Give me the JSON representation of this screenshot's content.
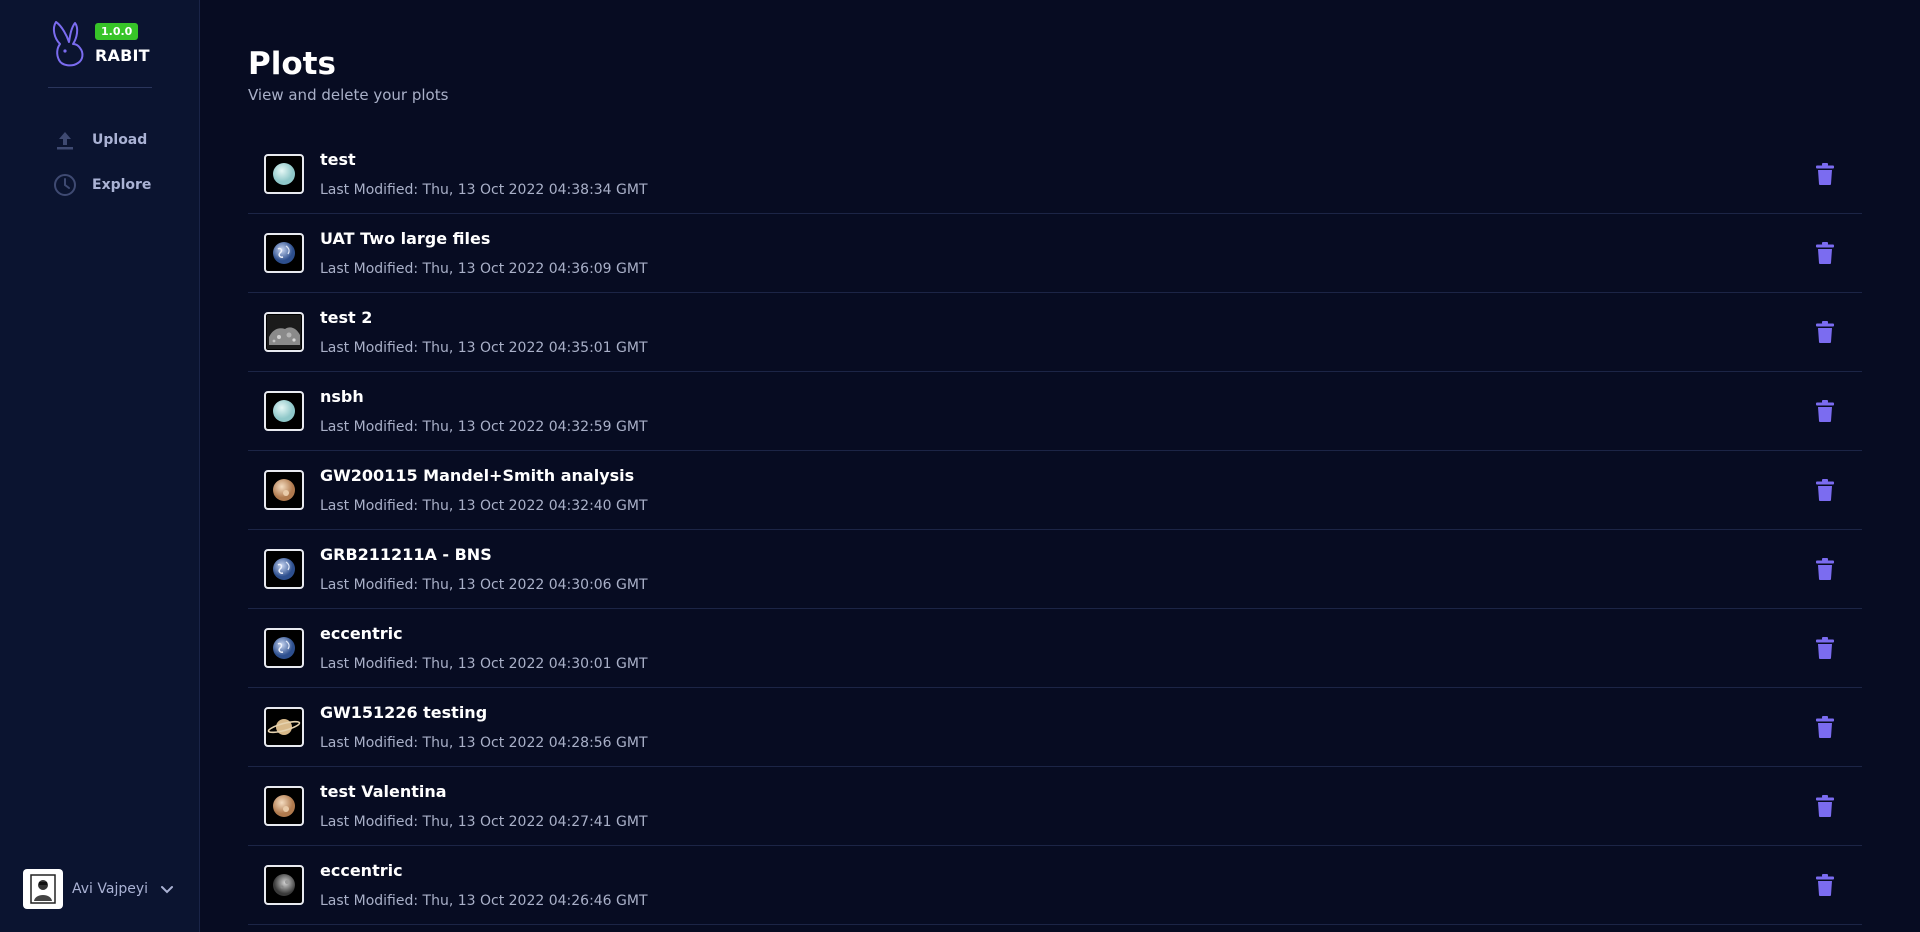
{
  "sidebar": {
    "version": "1.0.0",
    "app_name": "RABIT",
    "nav": [
      {
        "label": "Upload",
        "icon": "upload-icon"
      },
      {
        "label": "Explore",
        "icon": "clock-icon"
      }
    ],
    "user": {
      "name": "Avi Vajpeyi",
      "icon": "chevron-down-icon"
    }
  },
  "main": {
    "title": "Plots",
    "subtitle": "View and delete your plots"
  },
  "plots": [
    {
      "title": "test",
      "modified": "Last Modified: Thu, 13 Oct 2022 04:38:34 GMT",
      "thumb": "uranus"
    },
    {
      "title": "UAT Two large files",
      "modified": "Last Modified: Thu, 13 Oct 2022 04:36:09 GMT",
      "thumb": "earth"
    },
    {
      "title": "test 2",
      "modified": "Last Modified: Thu, 13 Oct 2022 04:35:01 GMT",
      "thumb": "asteroid"
    },
    {
      "title": "nsbh",
      "modified": "Last Modified: Thu, 13 Oct 2022 04:32:59 GMT",
      "thumb": "uranus"
    },
    {
      "title": "GW200115 Mandel+Smith analysis",
      "modified": "Last Modified: Thu, 13 Oct 2022 04:32:40 GMT",
      "thumb": "pluto"
    },
    {
      "title": "GRB211211A - BNS",
      "modified": "Last Modified: Thu, 13 Oct 2022 04:30:06 GMT",
      "thumb": "earth"
    },
    {
      "title": "eccentric",
      "modified": "Last Modified: Thu, 13 Oct 2022 04:30:01 GMT",
      "thumb": "earth"
    },
    {
      "title": "GW151226 testing",
      "modified": "Last Modified: Thu, 13 Oct 2022 04:28:56 GMT",
      "thumb": "saturn"
    },
    {
      "title": "test Valentina",
      "modified": "Last Modified: Thu, 13 Oct 2022 04:27:41 GMT",
      "thumb": "pluto"
    },
    {
      "title": "eccentric",
      "modified": "Last Modified: Thu, 13 Oct 2022 04:26:46 GMT",
      "thumb": "moon"
    }
  ],
  "colors": {
    "background": "#070c22",
    "sidebar": "#0b1430",
    "accent": "#7b6cf0",
    "version_badge": "#37c428"
  }
}
